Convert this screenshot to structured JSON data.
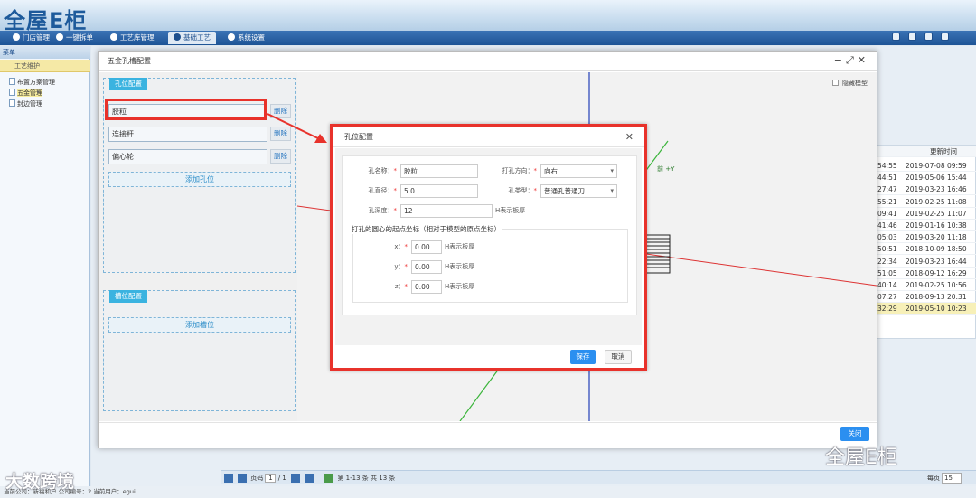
{
  "app": {
    "logo": "全屋E柜"
  },
  "nav": [
    "门店管理",
    "一键拆单",
    "工艺库管理",
    "基础工艺",
    "系统设置"
  ],
  "sidebar": {
    "header": "菜单",
    "section": "工艺维护",
    "items": [
      "布置方案管理",
      "五金管理",
      "封边管理"
    ]
  },
  "bg_table": {
    "header": "更新时间",
    "rows": [
      [
        "54:55",
        "2019-07-08 09:59"
      ],
      [
        "44:51",
        "2019-05-06 15:44"
      ],
      [
        "27:47",
        "2019-03-23 16:46"
      ],
      [
        "55:21",
        "2019-02-25 11:08"
      ],
      [
        "09:41",
        "2019-02-25 11:07"
      ],
      [
        "41:46",
        "2019-01-16 10:38"
      ],
      [
        "05:03",
        "2019-03-20 11:18"
      ],
      [
        "50:51",
        "2018-10-09 18:50"
      ],
      [
        "22:34",
        "2019-03-23 16:44"
      ],
      [
        "51:05",
        "2018-09-12 16:29"
      ],
      [
        "40:14",
        "2019-02-25 10:56"
      ],
      [
        "07:27",
        "2018-09-13 20:31"
      ],
      [
        "32:29",
        "2019-05-10 10:23"
      ]
    ]
  },
  "pager": {
    "page_label": "页码",
    "page": "1",
    "total_pages": "/ 1",
    "summary": "第 1-13 条  共 13 条",
    "per_page_label": "每页",
    "per_page": "15"
  },
  "status": "当前公司：新福和户  公司编号：2  当前用户：egui",
  "watermarks": {
    "left": "大数跨境",
    "right": "全屋E柜"
  },
  "main_dialog": {
    "title": "五金孔槽配置",
    "hole_section": "孔位配置",
    "holes": [
      "胶粒",
      "连接杆",
      "偏心轮"
    ],
    "delete_label": "删除",
    "add_hole": "添加孔位",
    "slot_section": "槽位配置",
    "add_slot": "添加槽位",
    "hide_model": "隐藏模型",
    "axis_label": "前 +Y",
    "close": "关闭"
  },
  "sub_dialog": {
    "title": "孔位配置",
    "name_label": "孔名称：",
    "name_value": "胶粒",
    "dir_label": "打孔方向：",
    "dir_value": "向右",
    "diameter_label": "孔直径：",
    "diameter_value": "5.0",
    "type_label": "孔类型：",
    "type_value": "普通孔普通刀",
    "depth_label": "孔深度：",
    "depth_value": "12",
    "depth_hint": "H表示板厚",
    "coord_title": "打孔的圆心的起点坐标（相对于模型的原点坐标）",
    "x_label": "x：",
    "x_value": "0.00",
    "y_label": "y：",
    "y_value": "0.00",
    "z_label": "z：",
    "z_value": "0.00",
    "coord_hint": "H表示板厚",
    "save": "保存",
    "cancel": "取消"
  },
  "colors": {
    "highlight": "#e8322b",
    "primary": "#2b8ff0",
    "tab": "#3ab3e0"
  }
}
